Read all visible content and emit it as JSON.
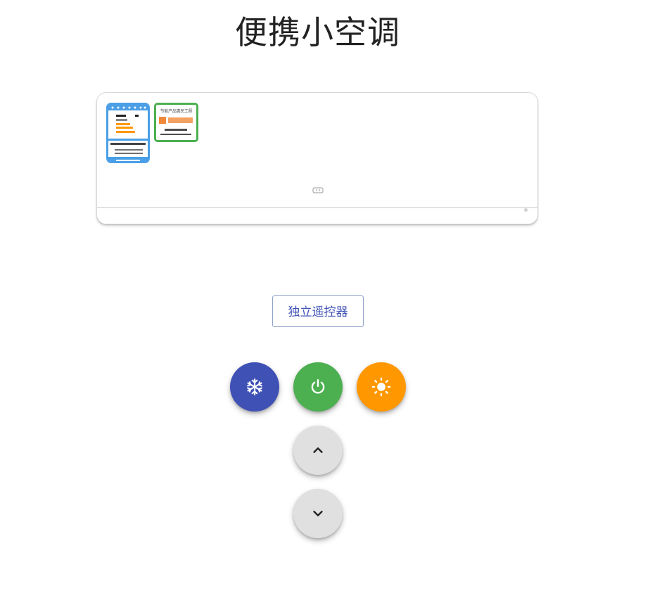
{
  "page": {
    "title": "便携小空调"
  },
  "ac_unit": {
    "cert_label_text": "节能产品惠民工程",
    "colors": {
      "energy_label": "#4a9fe6",
      "cert_border": "#4caf50"
    }
  },
  "remote": {
    "toggle_label": "独立遥控器"
  },
  "controls": {
    "cool_icon": "snowflake-icon",
    "power_icon": "power-icon",
    "heat_icon": "sun-icon",
    "up_icon": "chevron-up-icon",
    "down_icon": "chevron-down-icon",
    "colors": {
      "cool": "#3f51b5",
      "power": "#4caf50",
      "heat": "#ff9800",
      "neutral": "#e0e0e0"
    }
  }
}
